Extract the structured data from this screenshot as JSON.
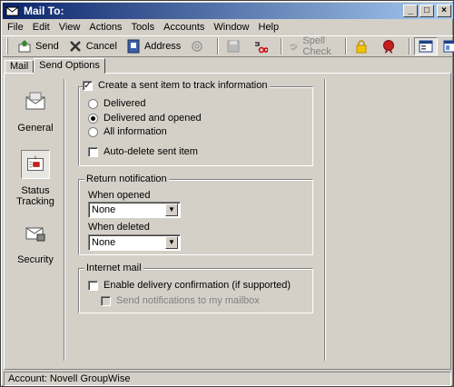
{
  "window": {
    "title": "Mail To:"
  },
  "menu": [
    "File",
    "Edit",
    "View",
    "Actions",
    "Tools",
    "Accounts",
    "Window",
    "Help"
  ],
  "toolbar": {
    "send": "Send",
    "cancel": "Cancel",
    "address": "Address",
    "spell_check": "Spell Check"
  },
  "tabs": {
    "mail": "Mail",
    "send_options": "Send Options"
  },
  "side_nav": {
    "general": "General",
    "status_tracking_1": "Status",
    "status_tracking_2": "Tracking",
    "security": "Security"
  },
  "tracking": {
    "create_sent_item": "Create a sent item to track information",
    "create_sent_item_checked": true,
    "delivered": "Delivered",
    "delivered_and_opened": "Delivered and opened",
    "all_information": "All information",
    "selected_option": "Delivered and opened",
    "auto_delete": "Auto-delete sent item"
  },
  "return_notification": {
    "title": "Return notification",
    "when_opened_label": "When opened",
    "when_opened_value": "None",
    "when_deleted_label": "When deleted",
    "when_deleted_value": "None"
  },
  "internet_mail": {
    "title": "Internet mail",
    "enable_delivery": "Enable delivery confirmation (if supported)",
    "send_notifications": "Send notifications to my mailbox"
  },
  "status": {
    "account": "Account: Novell GroupWise"
  },
  "colors": {
    "face": "#d4d0c8",
    "title_start": "#0a246a",
    "title_end": "#a6caf0"
  }
}
